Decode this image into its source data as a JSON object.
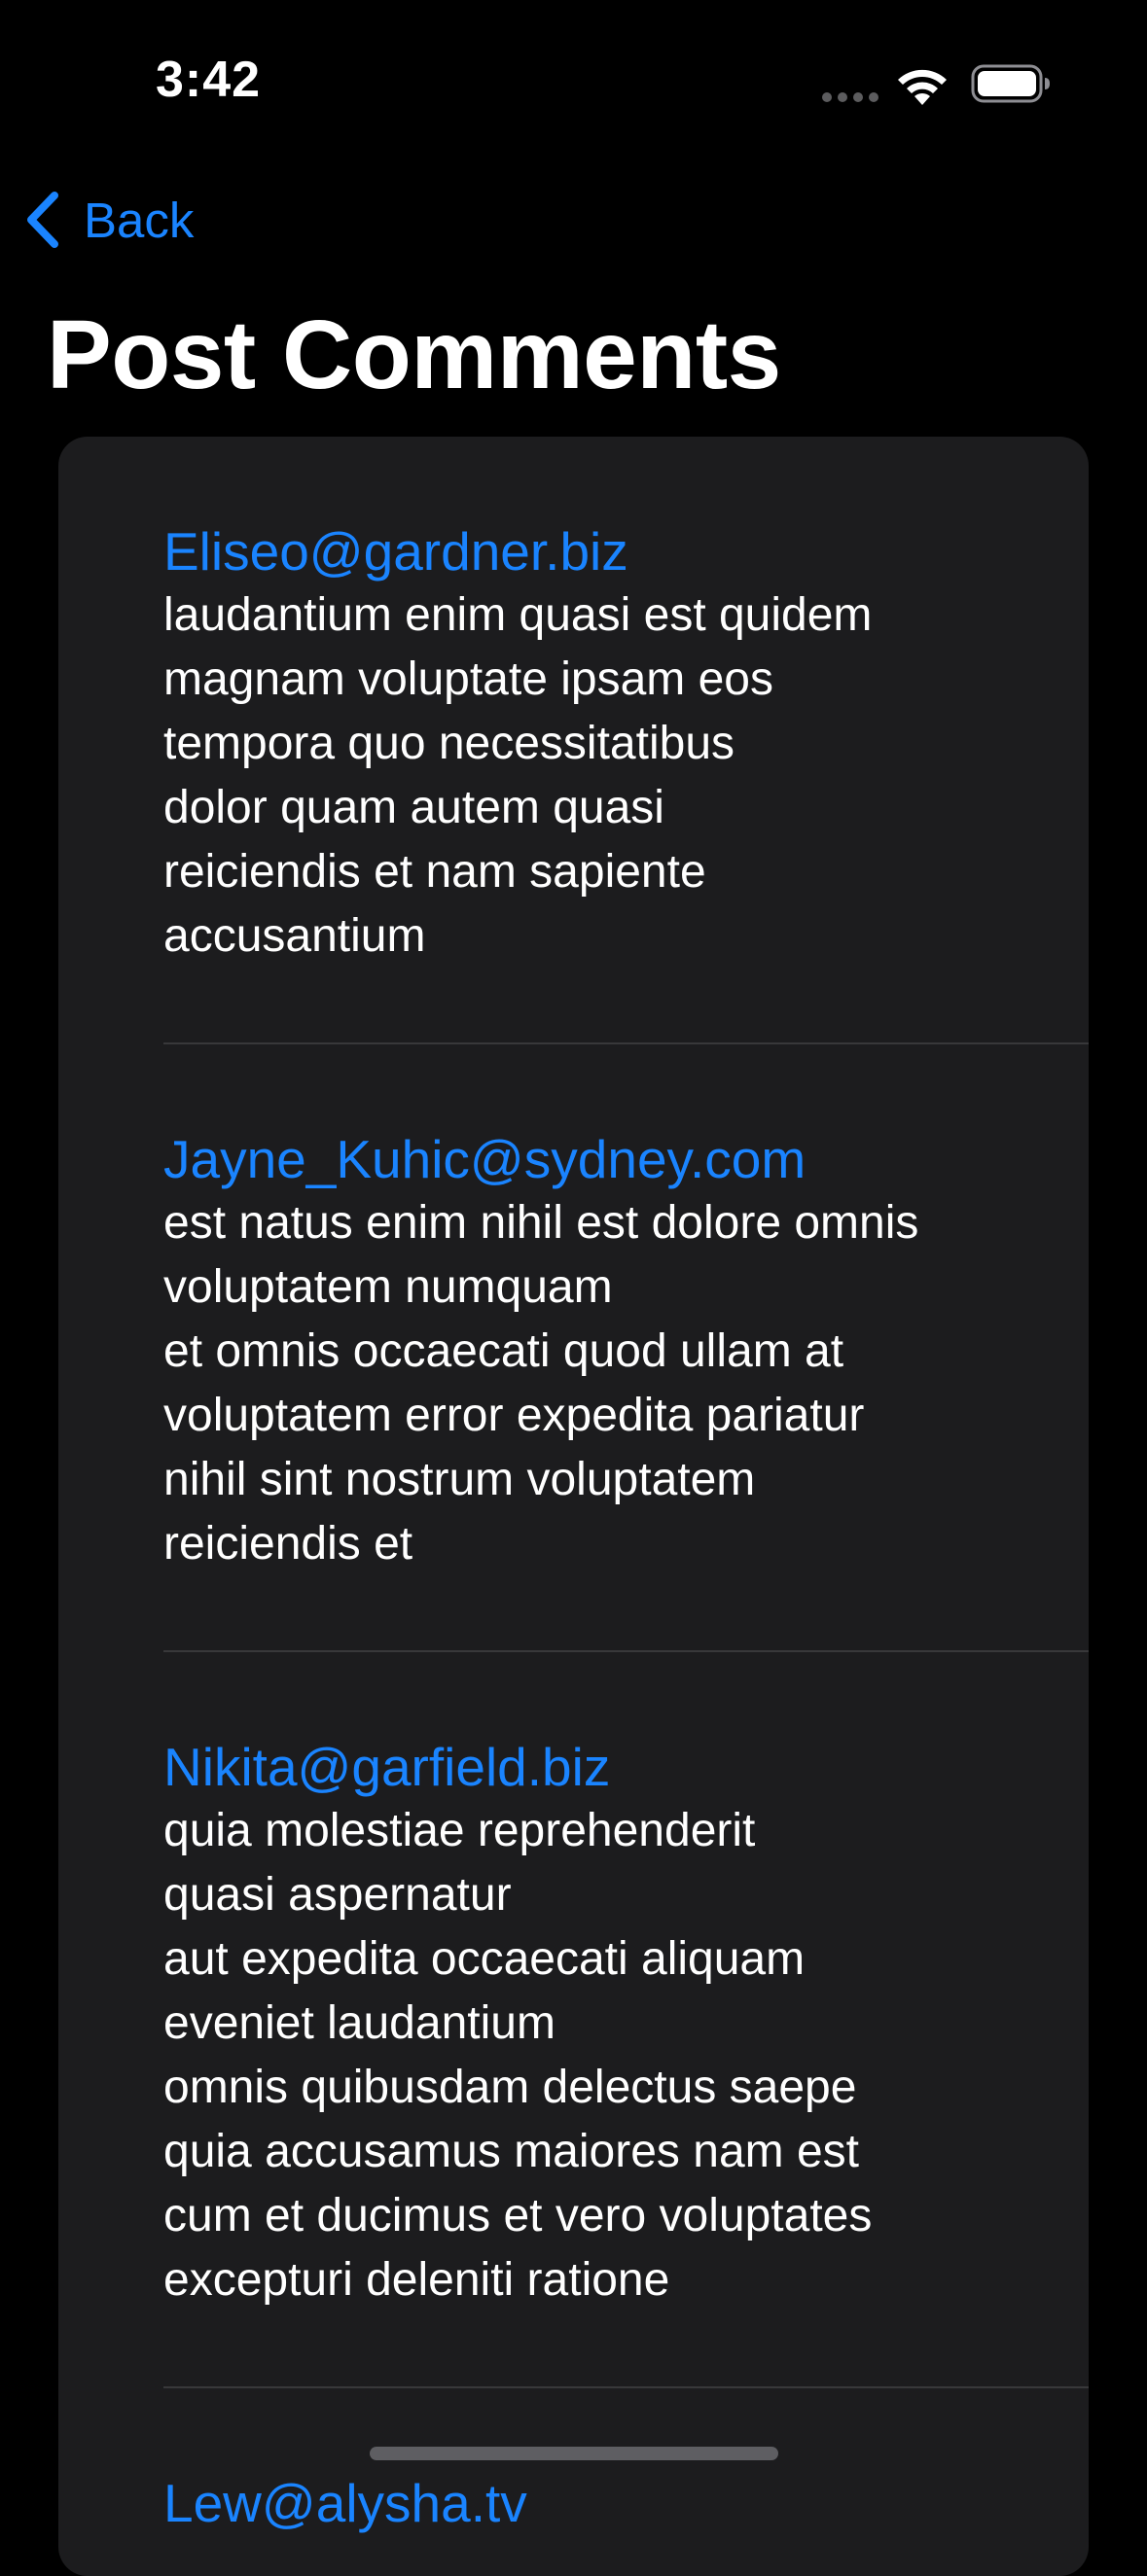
{
  "status_bar": {
    "time": "3:42"
  },
  "nav": {
    "back_label": "Back",
    "title": "Post Comments"
  },
  "comments": [
    {
      "email": "Eliseo@gardner.biz",
      "body_lines": [
        "laudantium enim quasi est quidem",
        "magnam voluptate ipsam eos",
        "tempora quo necessitatibus",
        "dolor quam autem quasi",
        "reiciendis et nam sapiente",
        "accusantium"
      ]
    },
    {
      "email": "Jayne_Kuhic@sydney.com",
      "body_lines": [
        "est natus enim nihil est dolore omnis",
        "voluptatem numquam",
        "et omnis occaecati quod ullam at",
        "voluptatem error expedita pariatur",
        "nihil sint nostrum voluptatem",
        "reiciendis et"
      ]
    },
    {
      "email": "Nikita@garfield.biz",
      "body_lines": [
        "quia molestiae reprehenderit",
        "quasi aspernatur",
        "aut expedita occaecati aliquam",
        "eveniet laudantium",
        "omnis quibusdam delectus saepe",
        "quia accusamus maiores nam est",
        "cum et ducimus et vero voluptates",
        "excepturi deleniti ratione"
      ]
    },
    {
      "email": "Lew@alysha.tv",
      "body_lines": []
    }
  ],
  "colors": {
    "accent": "#1a84ff",
    "background": "#000000",
    "card": "#1c1c1e",
    "separator": "#38383a"
  },
  "icons": [
    "wifi-icon",
    "battery-icon",
    "chevron-left-icon"
  ]
}
